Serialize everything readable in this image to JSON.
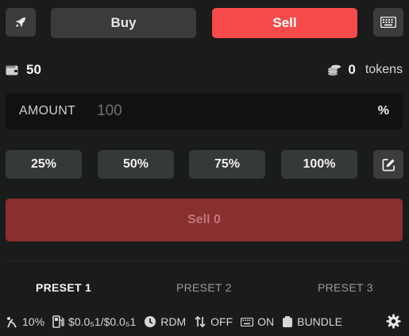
{
  "tabs": {
    "buy_label": "Buy",
    "sell_label": "Sell"
  },
  "balance": {
    "wallet_value": "50",
    "token_value": "0",
    "token_unit": "tokens"
  },
  "amount": {
    "label": "AMOUNT",
    "placeholder": "100",
    "value": "",
    "unit": "%"
  },
  "percent_buttons": [
    "25%",
    "50%",
    "75%",
    "100%"
  ],
  "submit": {
    "label": "Sell 0"
  },
  "presets": [
    {
      "label": "PRESET 1",
      "active": true
    },
    {
      "label": "PRESET 2",
      "active": false
    },
    {
      "label": "PRESET 3",
      "active": false
    }
  ],
  "footer": {
    "slippage": "10%",
    "fee": "$0.0₅1/$0.0₅1",
    "rdm": "RDM",
    "mev": "OFF",
    "keyboard": "ON",
    "bundle": "BUNDLE"
  },
  "colors": {
    "sell": "#f64a4a",
    "submit": "#882f2f",
    "background": "#1a1b1b"
  },
  "icons": [
    "rocket-icon",
    "keyboard-icon",
    "wallet-icon",
    "coins-icon",
    "edit-icon",
    "slippage-icon",
    "gas-pump-icon",
    "clock-icon",
    "arrows-up-down-icon",
    "bundle-icon",
    "gear-icon"
  ]
}
